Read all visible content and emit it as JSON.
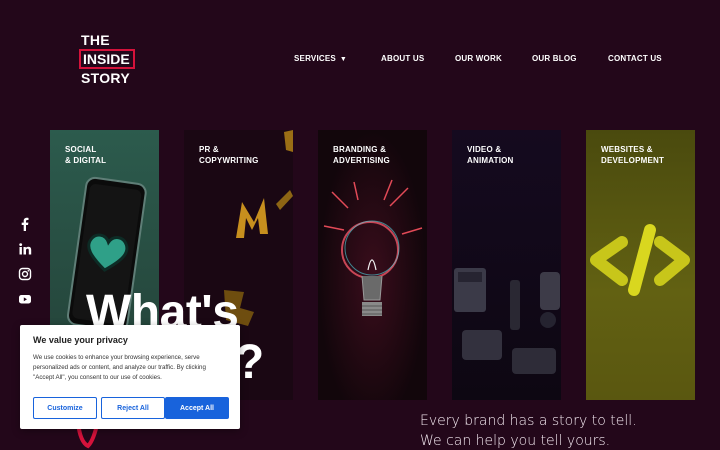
{
  "logo": {
    "line1": "THE",
    "line2": "INSIDE",
    "line3": "STORY",
    "accent": "#d5123b"
  },
  "nav": {
    "services": "SERVICES",
    "about": "ABOUT US",
    "work": "OUR WORK",
    "blog": "OUR BLOG",
    "contact": "CONTACT US"
  },
  "social": [
    "facebook-icon",
    "linkedin-icon",
    "instagram-icon",
    "youtube-icon"
  ],
  "cards": [
    {
      "label": "SOCIAL\n& DIGITAL"
    },
    {
      "label": "PR &\nCOPYWRITING"
    },
    {
      "label": "BRANDING &\nADVERTISING"
    },
    {
      "label": "VIDEO &\nANIMATION"
    },
    {
      "label": "WEBSITES &\nDEVELOPMENT"
    }
  ],
  "hero": {
    "line1": "What's",
    "line2": "story?"
  },
  "tagline": {
    "line1": "Every brand has a story to tell.",
    "line2": "We can help you tell yours."
  },
  "cookie": {
    "title": "We value your privacy",
    "text": "We use cookies to enhance your browsing experience, serve personalized ads or content, and analyze our traffic. By clicking \"Accept All\", you consent to our use of cookies.",
    "customize": "Customize",
    "reject": "Reject All",
    "accept": "Accept All"
  },
  "colors": {
    "background": "#23071a",
    "brand_red": "#d5123b",
    "cookie_blue": "#1863dc"
  }
}
